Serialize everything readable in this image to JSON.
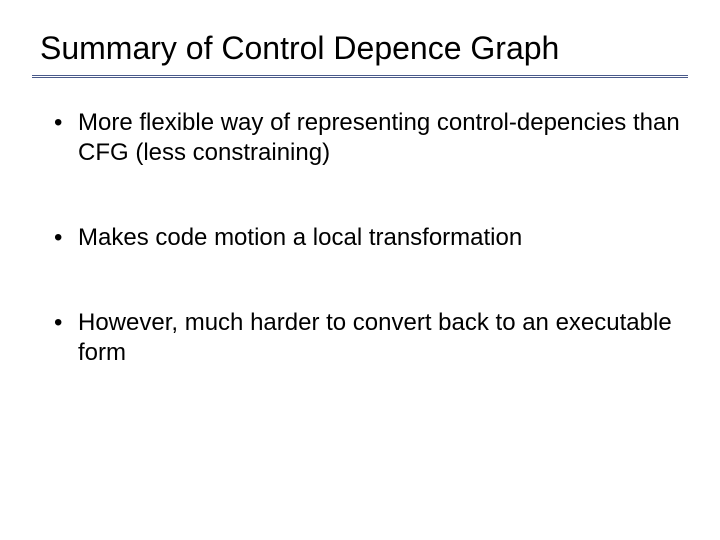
{
  "slide": {
    "title": "Summary of Control Depence Graph",
    "bullets": [
      "More flexible way of representing control-depencies than CFG (less constraining)",
      "Makes code motion a local transformation",
      "However, much harder to convert back to an executable form"
    ]
  }
}
